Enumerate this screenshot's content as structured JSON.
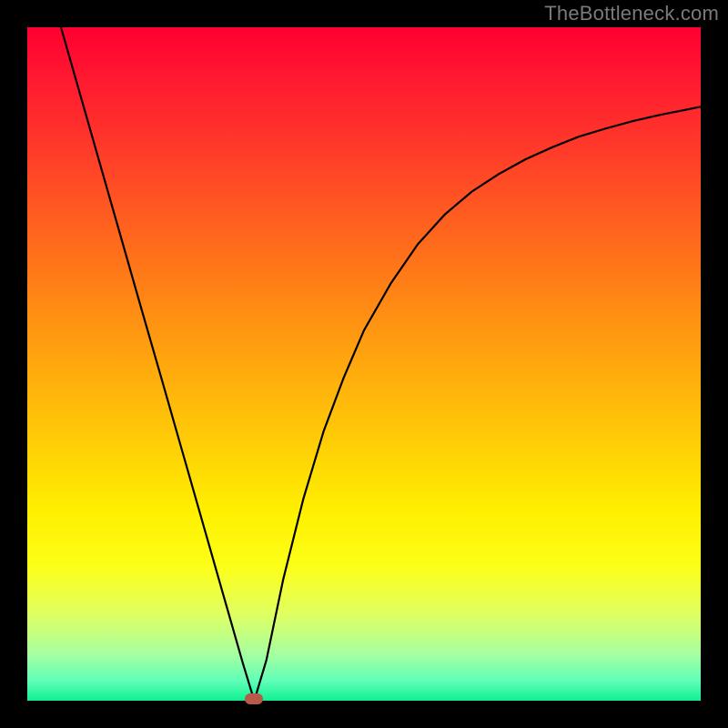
{
  "watermark": "TheBottleneck.com",
  "chart_data": {
    "type": "line",
    "title": "",
    "xlabel": "",
    "ylabel": "",
    "xlim": [
      0,
      1
    ],
    "ylim": [
      0,
      1
    ],
    "x": [
      0.05,
      0.08,
      0.11,
      0.14,
      0.17,
      0.2,
      0.23,
      0.26,
      0.29,
      0.32,
      0.337,
      0.355,
      0.38,
      0.41,
      0.44,
      0.47,
      0.5,
      0.54,
      0.58,
      0.62,
      0.66,
      0.7,
      0.74,
      0.78,
      0.82,
      0.86,
      0.9,
      0.94,
      0.98,
      1.0
    ],
    "values": [
      1.0,
      0.895,
      0.79,
      0.685,
      0.58,
      0.476,
      0.371,
      0.266,
      0.161,
      0.056,
      0.0,
      0.06,
      0.18,
      0.3,
      0.4,
      0.48,
      0.55,
      0.62,
      0.678,
      0.722,
      0.756,
      0.782,
      0.804,
      0.822,
      0.838,
      0.85,
      0.861,
      0.87,
      0.878,
      0.882
    ],
    "minimum_x": 0.337,
    "minimum_y": 0.0,
    "background_gradient": {
      "top": "#ff0030",
      "bottom": "#10f090"
    },
    "marker_color": "#b85a4a"
  }
}
